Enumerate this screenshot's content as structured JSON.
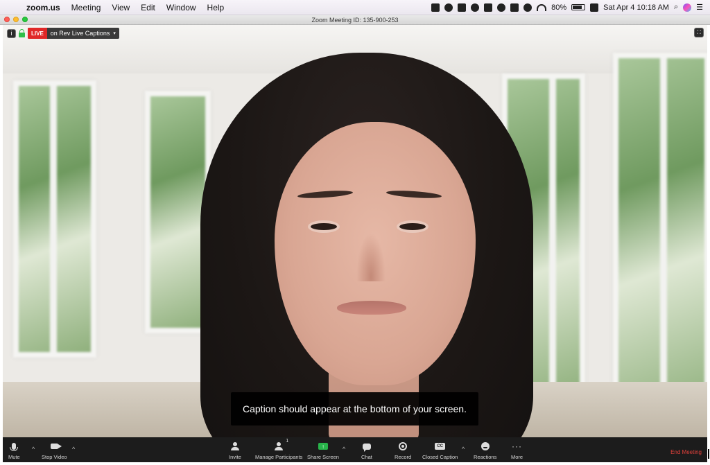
{
  "menubar": {
    "app_name": "zoom.us",
    "items": [
      "Meeting",
      "View",
      "Edit",
      "Window",
      "Help"
    ],
    "battery_percent": "80%",
    "clock": "Sat Apr 4  10:18 AM",
    "battery_level": 0.8
  },
  "window": {
    "title": "Zoom Meeting ID: 135-900-253"
  },
  "meeting_overlay": {
    "info_label": "i",
    "live_badge": "LIVE",
    "live_label": "on Rev Live Captions",
    "live_caret": "▾",
    "fullscreen_glyph": "⛶"
  },
  "caption": {
    "text": "Caption should appear at the bottom of your screen."
  },
  "toolbar": {
    "mute_label": "Mute",
    "stop_video_label": "Stop Video",
    "invite_label": "Invite",
    "manage_participants_label": "Manage Participants",
    "participant_count": "1",
    "share_screen_label": "Share Screen",
    "chat_label": "Chat",
    "record_label": "Record",
    "closed_caption_label": "Closed Caption",
    "cc_glyph": "CC",
    "reactions_label": "Reactions",
    "more_label": "More",
    "more_glyph": "···",
    "end_meeting_label": "End Meeting",
    "caret": "^"
  },
  "colors": {
    "live_red": "#e02828",
    "share_green": "#28b34a",
    "end_meeting_red": "#e0403a",
    "toolbar_bg": "#1c1c1c"
  }
}
